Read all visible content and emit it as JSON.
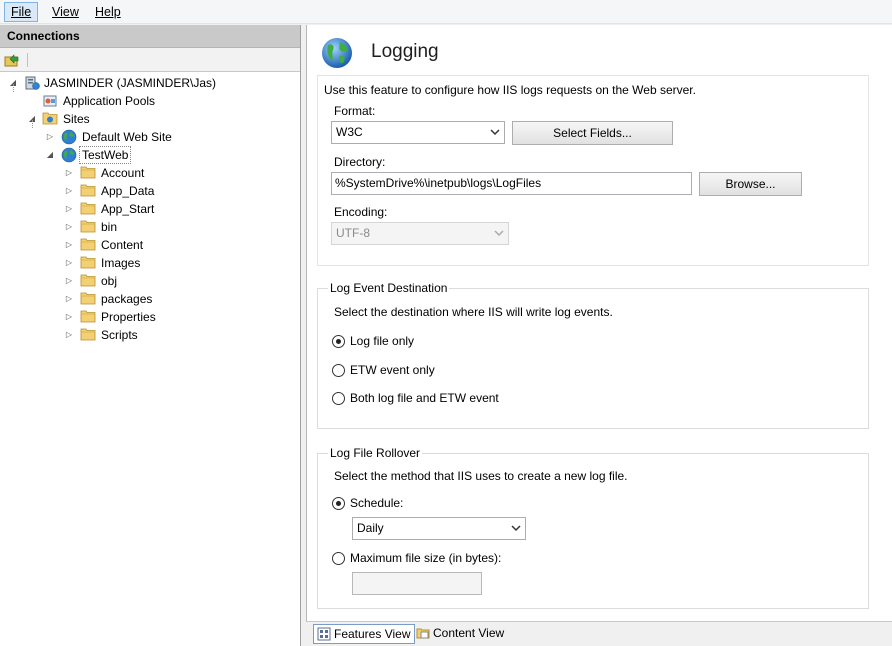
{
  "menu": {
    "file": "File",
    "view": "View",
    "help": "Help"
  },
  "connections": {
    "header": "Connections",
    "tree": {
      "server": "JASMINDER (JASMINDER\\Jas)",
      "app_pools": "Application Pools",
      "sites": "Sites",
      "default_site": "Default Web Site",
      "testweb": "TestWeb",
      "folders": [
        "Account",
        "App_Data",
        "App_Start",
        "bin",
        "Content",
        "Images",
        "obj",
        "packages",
        "Properties",
        "Scripts"
      ]
    }
  },
  "page": {
    "title": "Logging",
    "description": "Use this feature to configure how IIS logs requests on the Web server.",
    "format_label": "Format:",
    "format_value": "W3C",
    "select_fields": "Select Fields...",
    "directory_label": "Directory:",
    "directory_value": "%SystemDrive%\\inetpub\\logs\\LogFiles",
    "browse": "Browse...",
    "encoding_label": "Encoding:",
    "encoding_value": "UTF-8"
  },
  "destination": {
    "title": "Log Event Destination",
    "description": "Select the destination where IIS will write log events.",
    "options": [
      "Log file only",
      "ETW event only",
      "Both log file and ETW event"
    ],
    "selected_index": 0
  },
  "rollover": {
    "title": "Log File Rollover",
    "description": "Select the method that IIS uses to create a new log file.",
    "schedule_label": "Schedule:",
    "schedule_value": "Daily",
    "max_size_label": "Maximum file size (in bytes):",
    "max_size_value": "",
    "selected": "schedule"
  },
  "tabs": {
    "features_view": "Features View",
    "content_view": "Content View"
  },
  "colors": {
    "menu_active_bg": "#dbe8f6",
    "connections_header_bg": "#c9c9c9",
    "folder_yellow": "#f3d073"
  }
}
